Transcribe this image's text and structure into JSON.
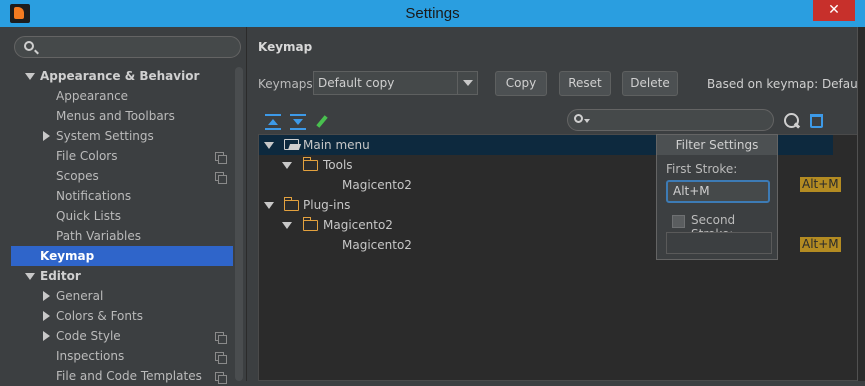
{
  "window": {
    "title": "Settings",
    "close_glyph": "✕"
  },
  "sidebar": {
    "search_placeholder": "",
    "items": [
      {
        "label": "Appearance & Behavior",
        "level": 0,
        "bold": true,
        "expanded": true
      },
      {
        "label": "Appearance",
        "level": 1
      },
      {
        "label": "Menus and Toolbars",
        "level": 1
      },
      {
        "label": "System Settings",
        "level": 1,
        "expandable": true
      },
      {
        "label": "File Colors",
        "level": 1,
        "copy_icon": true
      },
      {
        "label": "Scopes",
        "level": 1,
        "copy_icon": true
      },
      {
        "label": "Notifications",
        "level": 1
      },
      {
        "label": "Quick Lists",
        "level": 1
      },
      {
        "label": "Path Variables",
        "level": 1
      },
      {
        "label": "Keymap",
        "level": 0,
        "bold": true,
        "selected": true
      },
      {
        "label": "Editor",
        "level": 0,
        "bold": true,
        "expanded": true
      },
      {
        "label": "General",
        "level": 1,
        "expandable": true
      },
      {
        "label": "Colors & Fonts",
        "level": 1,
        "expandable": true
      },
      {
        "label": "Code Style",
        "level": 1,
        "expandable": true,
        "copy_icon": true
      },
      {
        "label": "Inspections",
        "level": 1,
        "copy_icon": true
      },
      {
        "label": "File and Code Templates",
        "level": 1,
        "copy_icon": true
      }
    ]
  },
  "main": {
    "title": "Keymap",
    "keymaps_label": "Keymaps:",
    "keymap_value": "Default copy",
    "copy_label": "Copy",
    "reset_label": "Reset",
    "delete_label": "Delete",
    "based_on": "Based on keymap: Default",
    "filter_placeholder": "",
    "tree": [
      {
        "label": "Main menu",
        "type": "menu-root",
        "expanded": true,
        "selected": true
      },
      {
        "label": "Tools",
        "type": "folder",
        "expanded": true
      },
      {
        "label": "Magicento2",
        "type": "action",
        "shortcut": "Alt+M"
      },
      {
        "label": "Plug-ins",
        "type": "folder",
        "expanded": true
      },
      {
        "label": "Magicento2",
        "type": "folder",
        "expanded": true
      },
      {
        "label": "Magicento2",
        "type": "action",
        "shortcut": "Alt+M"
      }
    ]
  },
  "filter_popup": {
    "title": "Filter Settings",
    "first_stroke_label": "First Stroke:",
    "first_stroke_value": "Alt+M",
    "second_stroke_label": "Second Stroke:",
    "second_stroke_checked": false,
    "second_stroke_value": ""
  },
  "colors": {
    "accent": "#2a9ee0",
    "selection": "#2f65ca",
    "shortcut_badge": "#b38b22",
    "folder": "#e3a13e"
  }
}
